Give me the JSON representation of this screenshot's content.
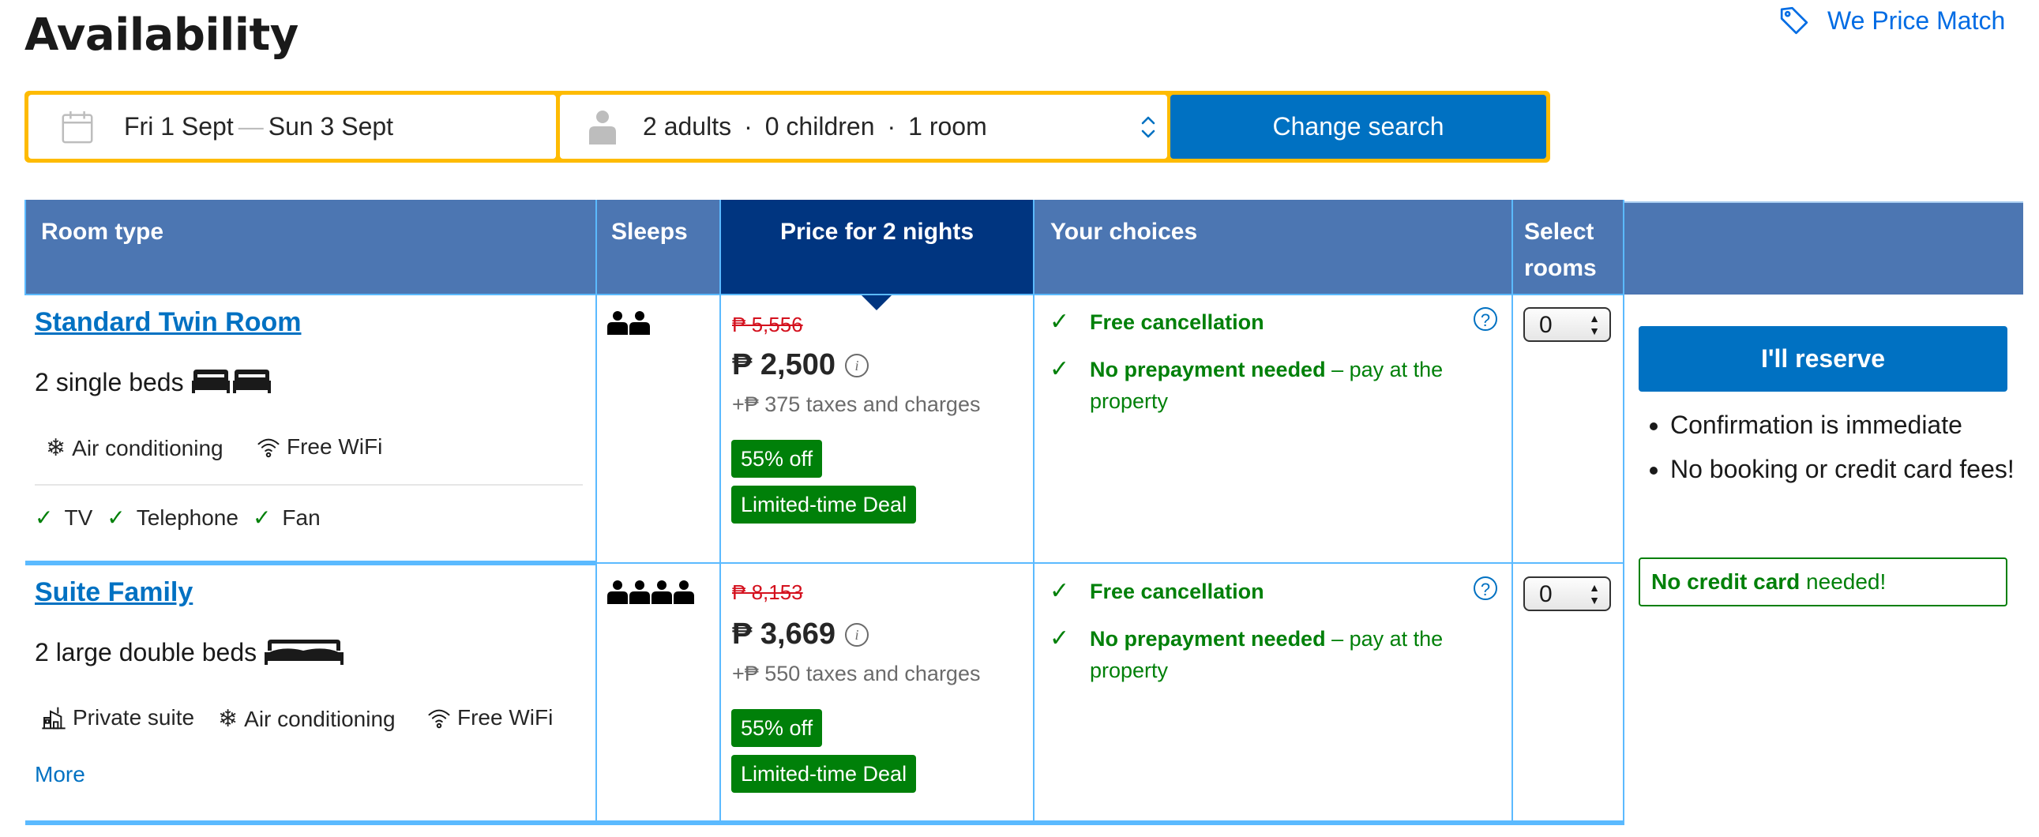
{
  "page": {
    "title": "Availability",
    "price_match": "We Price Match"
  },
  "search": {
    "check_in": "Fri 1 Sept",
    "separator": "—",
    "check_out": "Sun 3 Sept",
    "adults": "2 adults",
    "children": "0 children",
    "rooms": "1 room",
    "dot": "·",
    "button": "Change search"
  },
  "table": {
    "headers": {
      "room_type": "Room type",
      "sleeps": "Sleeps",
      "price": "Price for 2 nights",
      "choices": "Your choices",
      "select_line1": "Select",
      "select_line2": "rooms"
    },
    "rooms": [
      {
        "name": "Standard Twin Room",
        "beds": "2 single beds",
        "amenities": [
          "Air conditioning",
          "Free WiFi"
        ],
        "extras": [
          "TV",
          "Telephone",
          "Fan"
        ],
        "sleeps": 2,
        "old_price": "₱ 5,556",
        "price": "₱ 2,500",
        "taxes": "+₱ 375 taxes and charges",
        "badges": [
          "55% off",
          "Limited-time Deal"
        ],
        "choices": {
          "free_cancel": "Free cancellation",
          "no_prepay_bold": "No prepayment needed",
          "no_prepay_rest": " – pay at the property"
        },
        "selected_qty": "0"
      },
      {
        "name": "Suite Family",
        "beds": "2 large double beds",
        "amenities": [
          "Private suite",
          "Air conditioning",
          "Free WiFi"
        ],
        "more_link": "More",
        "sleeps": 4,
        "old_price": "₱ 8,153",
        "price": "₱ 3,669",
        "taxes": "+₱ 550 taxes and charges",
        "badges": [
          "55% off",
          "Limited-time Deal"
        ],
        "choices": {
          "free_cancel": "Free cancellation",
          "no_prepay_bold": "No prepayment needed",
          "no_prepay_rest": " – pay at the property"
        },
        "selected_qty": "0"
      }
    ]
  },
  "reserve": {
    "button": "I'll reserve",
    "bullets": [
      "Confirmation is immediate",
      "No booking or credit card fees!"
    ],
    "no_cc_bold": "No credit card",
    "no_cc_rest": " needed!"
  },
  "colors": {
    "brand_blue": "#0071c2",
    "header_blue": "#4c76b2",
    "header_active": "#003580",
    "search_yellow": "#febb02",
    "green": "#008009",
    "red": "#d4111e"
  }
}
